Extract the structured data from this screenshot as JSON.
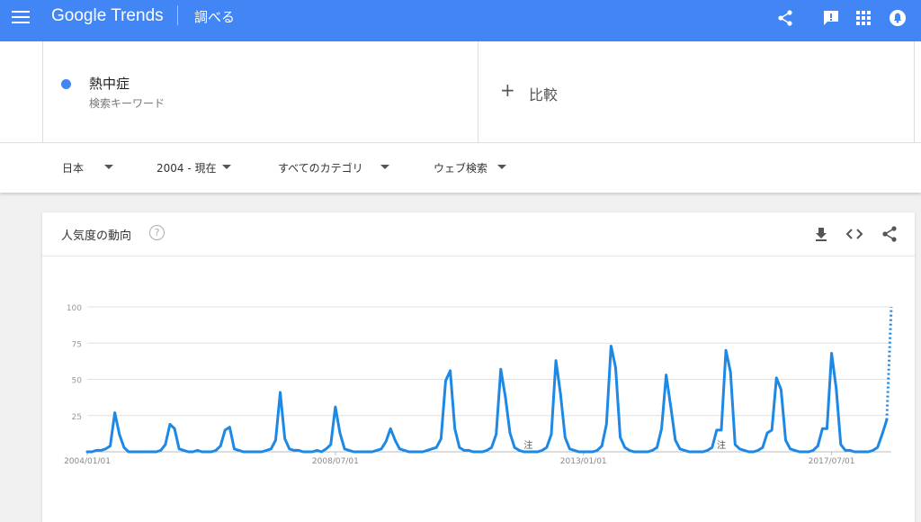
{
  "header": {
    "logo": "Google Trends",
    "section": "調べる",
    "icons": [
      "menu-icon",
      "share-icon",
      "feedback-icon",
      "apps-icon",
      "account-icon"
    ]
  },
  "search": {
    "term": "熱中症",
    "term_type": "検索キーワード",
    "term_color": "#4285f4",
    "compare_plus": "+",
    "compare_label": "比較"
  },
  "filters": {
    "region": "日本",
    "period": "2004 - 現在",
    "category": "すべてのカテゴリ",
    "property": "ウェブ検索"
  },
  "card": {
    "title": "人気度の動向",
    "help": "?",
    "icons": [
      "download-icon",
      "embed-icon",
      "share-icon"
    ]
  },
  "chart_data": {
    "type": "line",
    "x": [
      "2004/01",
      "2004/02",
      "2004/03",
      "2004/04",
      "2004/05",
      "2004/06",
      "2004/07",
      "2004/08",
      "2004/09",
      "2004/10",
      "2004/11",
      "2004/12",
      "2005/01",
      "2005/02",
      "2005/03",
      "2005/04",
      "2005/05",
      "2005/06",
      "2005/07",
      "2005/08",
      "2005/09",
      "2005/10",
      "2005/11",
      "2005/12",
      "2006/01",
      "2006/02",
      "2006/03",
      "2006/04",
      "2006/05",
      "2006/06",
      "2006/07",
      "2006/08",
      "2006/09",
      "2006/10",
      "2006/11",
      "2006/12",
      "2007/01",
      "2007/02",
      "2007/03",
      "2007/04",
      "2007/05",
      "2007/06",
      "2007/07",
      "2007/08",
      "2007/09",
      "2007/10",
      "2007/11",
      "2007/12",
      "2008/01",
      "2008/02",
      "2008/03",
      "2008/04",
      "2008/05",
      "2008/06",
      "2008/07",
      "2008/08",
      "2008/09",
      "2008/10",
      "2008/11",
      "2008/12",
      "2009/01",
      "2009/02",
      "2009/03",
      "2009/04",
      "2009/05",
      "2009/06",
      "2009/07",
      "2009/08",
      "2009/09",
      "2009/10",
      "2009/11",
      "2009/12",
      "2010/01",
      "2010/02",
      "2010/03",
      "2010/04",
      "2010/05",
      "2010/06",
      "2010/07",
      "2010/08",
      "2010/09",
      "2010/10",
      "2010/11",
      "2010/12",
      "2011/01",
      "2011/02",
      "2011/03",
      "2011/04",
      "2011/05",
      "2011/06",
      "2011/07",
      "2011/08",
      "2011/09",
      "2011/10",
      "2011/11",
      "2011/12",
      "2012/01",
      "2012/02",
      "2012/03",
      "2012/04",
      "2012/05",
      "2012/06",
      "2012/07",
      "2012/08",
      "2012/09",
      "2012/10",
      "2012/11",
      "2012/12",
      "2013/01",
      "2013/02",
      "2013/03",
      "2013/04",
      "2013/05",
      "2013/06",
      "2013/07",
      "2013/08",
      "2013/09",
      "2013/10",
      "2013/11",
      "2013/12",
      "2014/01",
      "2014/02",
      "2014/03",
      "2014/04",
      "2014/05",
      "2014/06",
      "2014/07",
      "2014/08",
      "2014/09",
      "2014/10",
      "2014/11",
      "2014/12",
      "2015/01",
      "2015/02",
      "2015/03",
      "2015/04",
      "2015/05",
      "2015/06",
      "2015/07",
      "2015/08",
      "2015/09",
      "2015/10",
      "2015/11",
      "2015/12",
      "2016/01",
      "2016/02",
      "2016/03",
      "2016/04",
      "2016/05",
      "2016/06",
      "2016/07",
      "2016/08",
      "2016/09",
      "2016/10",
      "2016/11",
      "2016/12",
      "2017/01",
      "2017/02",
      "2017/03",
      "2017/04",
      "2017/05",
      "2017/06",
      "2017/07",
      "2017/08",
      "2017/09",
      "2017/10",
      "2017/11",
      "2017/12",
      "2018/01",
      "2018/02",
      "2018/03",
      "2018/04",
      "2018/05",
      "2018/06",
      "2018/07"
    ],
    "series": [
      {
        "name": "熱中症",
        "color": "#1e88e5",
        "values": [
          0,
          0,
          1,
          1,
          2,
          4,
          27,
          12,
          3,
          0,
          0,
          0,
          0,
          0,
          0,
          0,
          1,
          5,
          19,
          16,
          2,
          1,
          0,
          0,
          1,
          0,
          0,
          0,
          1,
          4,
          15,
          17,
          2,
          1,
          0,
          0,
          0,
          0,
          0,
          1,
          2,
          8,
          41,
          9,
          2,
          1,
          1,
          0,
          0,
          0,
          1,
          0,
          2,
          5,
          31,
          13,
          2,
          1,
          0,
          0,
          0,
          0,
          0,
          1,
          2,
          7,
          16,
          8,
          2,
          1,
          0,
          0,
          0,
          0,
          1,
          2,
          3,
          9,
          49,
          56,
          16,
          3,
          1,
          1,
          0,
          0,
          0,
          1,
          3,
          12,
          57,
          38,
          13,
          3,
          1,
          0,
          0,
          0,
          0,
          1,
          3,
          12,
          63,
          40,
          10,
          2,
          1,
          0,
          0,
          0,
          0,
          1,
          4,
          19,
          73,
          58,
          10,
          3,
          1,
          0,
          0,
          0,
          0,
          1,
          3,
          16,
          53,
          31,
          8,
          2,
          1,
          0,
          0,
          0,
          0,
          1,
          3,
          15,
          15,
          70,
          55,
          5,
          2,
          1,
          0,
          0,
          1,
          3,
          13,
          15,
          51,
          43,
          8,
          2,
          1,
          0,
          0,
          0,
          1,
          4,
          16,
          16,
          68,
          44,
          5,
          1,
          1,
          0,
          0,
          0,
          0,
          1,
          3,
          12,
          22
        ]
      },
      {
        "name": "partial",
        "style": "dotted",
        "x": [
          "2018/07",
          "2018/08"
        ],
        "values": [
          22,
          100
        ]
      }
    ],
    "y_ticks": [
      100,
      75,
      50,
      25
    ],
    "x_tick_labels": [
      "2004/01/01",
      "2008/07/01",
      "2013/01/01",
      "2017/07/01"
    ],
    "annotations": [
      "注",
      "注"
    ],
    "ylim": [
      0,
      100
    ],
    "grid": true
  }
}
